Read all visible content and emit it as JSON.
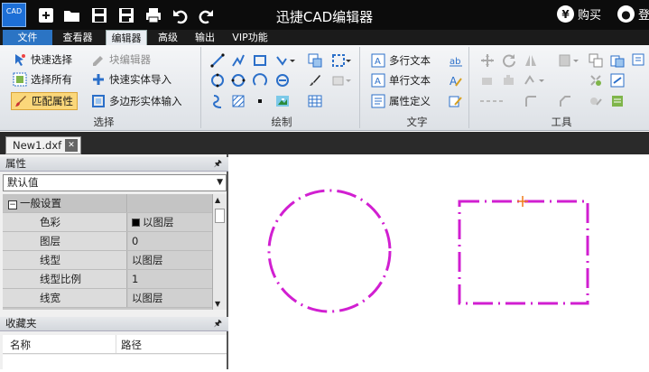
{
  "app": {
    "title": "迅捷CAD编辑器",
    "logo_text": "CAD",
    "buy_label": "购买",
    "login_label": "登"
  },
  "quick_access": [
    "new-icon",
    "open-icon",
    "save-icon",
    "save-as-icon",
    "print-icon",
    "undo-icon",
    "redo-icon"
  ],
  "menu": {
    "file": "文件",
    "items": [
      "查看器",
      "编辑器",
      "高级",
      "输出",
      "VIP功能"
    ],
    "active": "编辑器"
  },
  "ribbon": {
    "select_group": {
      "label": "选择",
      "quick_select": "快速选择",
      "block_editor": "块编辑器",
      "select_all": "选择所有",
      "quick_entity_import": "快速实体导入",
      "match_properties": "匹配属性",
      "polygon_entity_input": "多边形实体输入"
    },
    "draw_group": {
      "label": "绘制"
    },
    "text_group": {
      "label": "文字",
      "multiline_text": "多行文本",
      "single_line_text": "单行文本",
      "attribute_definition": "属性定义"
    },
    "tools_group": {
      "label": "工具"
    }
  },
  "document_tab": {
    "name": "New1.dxf"
  },
  "properties_panel": {
    "title": "属性",
    "dropdown_value": "默认值",
    "category": "一般设置",
    "rows": [
      {
        "key": "色彩",
        "value": "以图层"
      },
      {
        "key": "图层",
        "value": "0"
      },
      {
        "key": "线型",
        "value": "以图层"
      },
      {
        "key": "线型比例",
        "value": "1"
      },
      {
        "key": "线宽",
        "value": "以图层"
      }
    ]
  },
  "favorites_panel": {
    "title": "收藏夹",
    "col_name": "名称",
    "col_path": "路径"
  },
  "colors": {
    "accent_blue": "#2b74c4",
    "highlight": "#fbd77a",
    "drawing_magenta": "#d11fd1",
    "cursor_orange": "#f07a1a"
  }
}
